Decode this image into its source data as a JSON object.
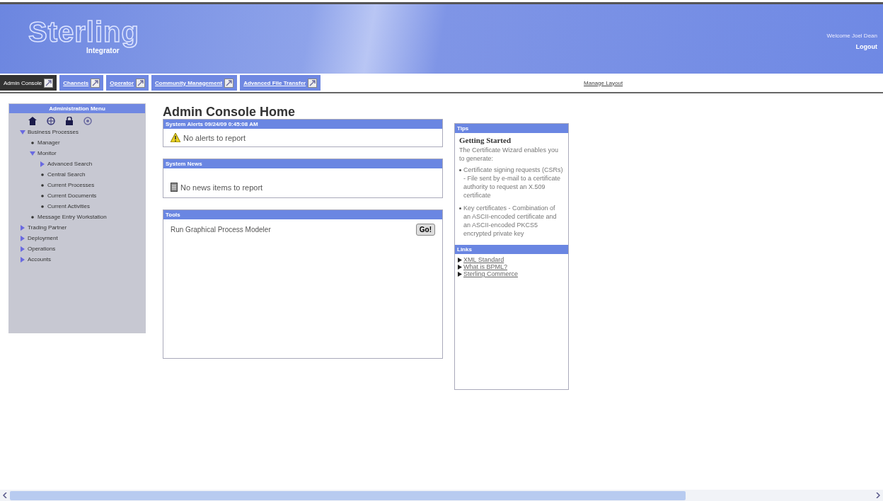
{
  "header": {
    "logo": "Sterling",
    "logo_sub": "Integrator",
    "welcome": "Welcome Joel Dean",
    "logout": "Logout"
  },
  "tabs": [
    {
      "label": "Admin Console",
      "selected": true
    },
    {
      "label": "Channels",
      "selected": false
    },
    {
      "label": "Operator",
      "selected": false
    },
    {
      "label": "Community Management",
      "selected": false
    },
    {
      "label": "Advanced File Transfer",
      "selected": false
    }
  ],
  "manage_layout": "Manage Layout",
  "sidebar": {
    "title": "Administration Menu",
    "items": [
      {
        "label": "Business Processes",
        "kind": "folder",
        "expanded": true,
        "children": [
          {
            "label": "Manager",
            "kind": "leaf"
          },
          {
            "label": "Monitor",
            "kind": "folder",
            "expanded": true,
            "children": [
              {
                "label": "Advanced Search",
                "kind": "folder",
                "expanded": false
              },
              {
                "label": "Central Search",
                "kind": "leaf"
              },
              {
                "label": "Current Processes",
                "kind": "leaf"
              },
              {
                "label": "Current Documents",
                "kind": "leaf"
              },
              {
                "label": "Current Activities",
                "kind": "leaf"
              }
            ]
          },
          {
            "label": "Message Entry Workstation",
            "kind": "leaf"
          }
        ]
      },
      {
        "label": "Trading Partner",
        "kind": "folder",
        "expanded": false
      },
      {
        "label": "Deployment",
        "kind": "folder",
        "expanded": false
      },
      {
        "label": "Operations",
        "kind": "folder",
        "expanded": false
      },
      {
        "label": "Accounts",
        "kind": "folder",
        "expanded": false
      }
    ]
  },
  "page_title": "Admin Console Home",
  "alerts": {
    "title": "System Alerts 09/24/09 0:45:08 AM",
    "message": "No alerts to report"
  },
  "news": {
    "title": "System News",
    "message": "No news items to report"
  },
  "tools": {
    "title": "Tools",
    "items": [
      {
        "label": "Run Graphical Process Modeler",
        "button": "Go!"
      }
    ]
  },
  "tips": {
    "title": "Tips",
    "heading": "Getting Started",
    "intro": "The Certificate Wizard enables you to generate:",
    "bullets": [
      "Certificate signing requests (CSRs) - File sent by e-mail to a certificate authority to request an X.509 certificate",
      "Key certificates - Combination of an ASCII-encoded certificate and an ASCII-encoded PKCS5 encrypted private key"
    ]
  },
  "links": {
    "title": "Links",
    "items": [
      "XML Standard",
      "What is BPML?",
      "Sterling Commerce"
    ]
  }
}
